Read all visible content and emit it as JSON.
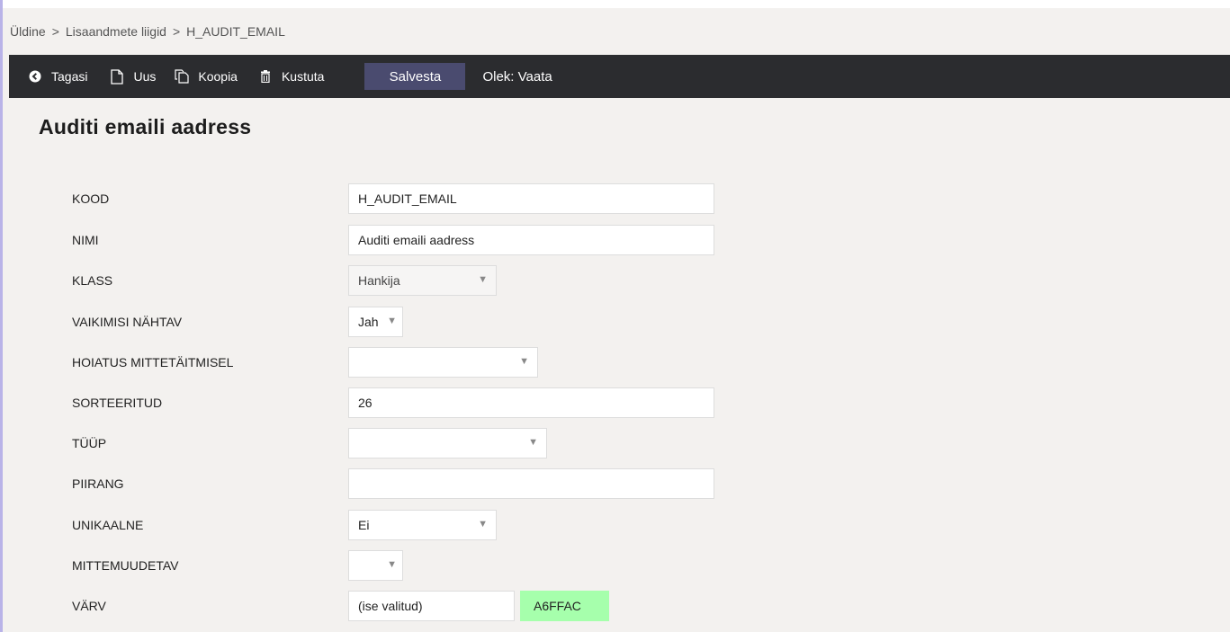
{
  "breadcrumb": {
    "items": [
      "Üldine",
      "Lisaandmete liigid",
      "H_AUDIT_EMAIL"
    ],
    "separator": ">"
  },
  "toolbar": {
    "back_label": "Tagasi",
    "new_label": "Uus",
    "copy_label": "Koopia",
    "delete_label": "Kustuta",
    "save_label": "Salvesta",
    "status_text": "Olek: Vaata"
  },
  "page": {
    "title": "Auditi emaili aadress"
  },
  "form": {
    "kood": {
      "label": "KOOD",
      "value": "H_AUDIT_EMAIL"
    },
    "nimi": {
      "label": "NIMI",
      "value": "Auditi emaili aadress"
    },
    "klass": {
      "label": "KLASS",
      "value": "Hankija"
    },
    "vaikimisi": {
      "label": "VAIKIMISI NÄHTAV",
      "value": "Jah"
    },
    "hoiatus": {
      "label": "HOIATUS MITTETÄITMISEL",
      "value": ""
    },
    "sorteeritud": {
      "label": "SORTEERITUD",
      "value": "26"
    },
    "tyyp": {
      "label": "TÜÜP",
      "value": ""
    },
    "piirang": {
      "label": "PIIRANG",
      "value": ""
    },
    "unikaalne": {
      "label": "UNIKAALNE",
      "value": "Ei"
    },
    "mittemuudetav": {
      "label": "MITTEMUUDETAV",
      "value": ""
    },
    "varv": {
      "label": "VÄRV",
      "value": "(ise valitud)",
      "color_code": "A6FFAC",
      "color_hex": "#a6ffac"
    }
  },
  "icons": {
    "back": "back-circle-icon",
    "new": "new-document-icon",
    "copy": "copy-icon",
    "delete": "trash-icon",
    "dropdown": "caret-down-icon"
  }
}
